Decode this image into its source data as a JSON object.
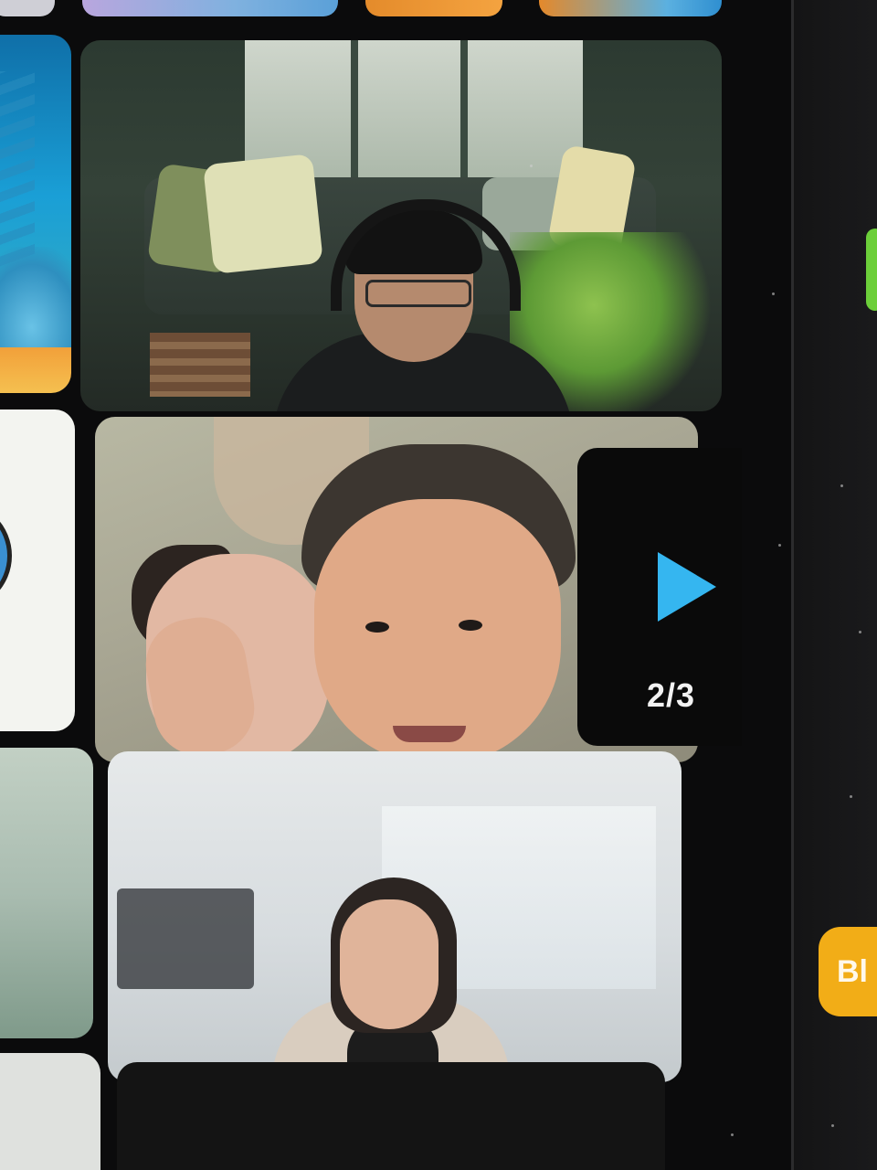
{
  "app": {
    "kind": "video-call-gallery",
    "accent": "#35b6f0",
    "button_color": "#f2ad17"
  },
  "gallery": {
    "pager": {
      "next_icon": "play-triangle-icon",
      "page_indicator": "2/3"
    },
    "tiles": [
      {
        "description": "participant-tile"
      },
      {
        "description": "participant-tile"
      },
      {
        "description": "participant-tile"
      }
    ]
  },
  "side_panel": {
    "button_label_partial": "Bl"
  }
}
